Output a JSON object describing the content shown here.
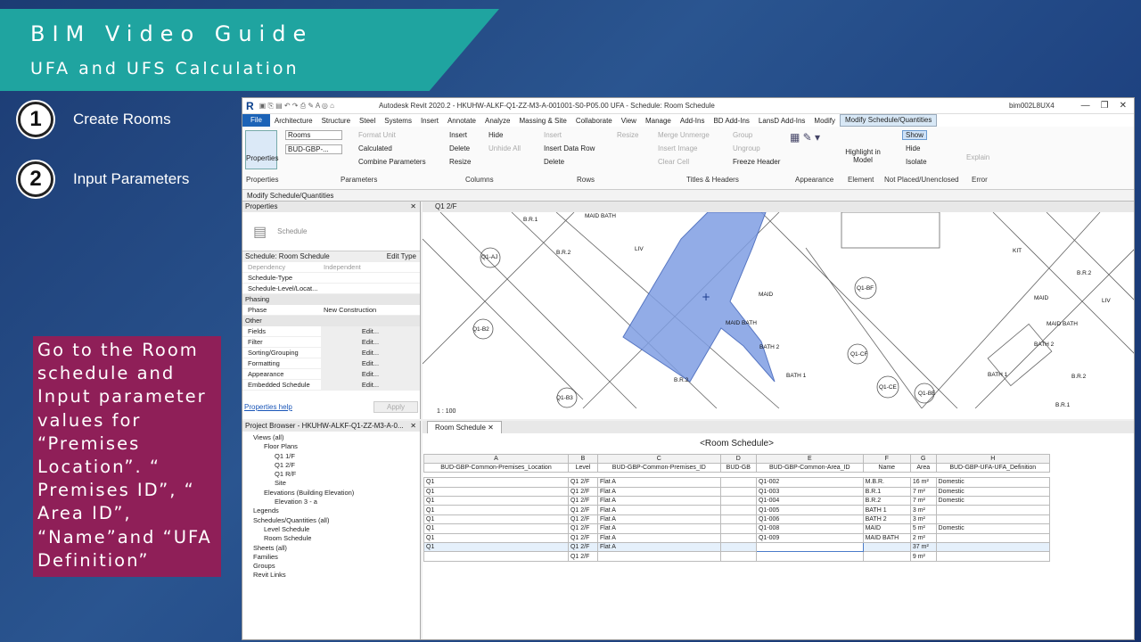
{
  "banner": {
    "title": "BIM Video Guide",
    "subtitle": "UFA and UFS Calculation"
  },
  "steps": [
    {
      "num": "1",
      "label": "Create Rooms"
    },
    {
      "num": "2",
      "label": "Input Parameters"
    }
  ],
  "note": "Go to the Room schedule and Input parameter values for “Premises Location”. “ Premises ID”, “ Area ID”, “Name”and “UFA Definition”",
  "app": {
    "title": "Autodesk Revit 2020.2 - HKUHW-ALKF-Q1-ZZ-M3-A-001001-S0-P05.00 UFA - Schedule: Room Schedule",
    "user": "bim002L8UX4",
    "menu": [
      "File",
      "Architecture",
      "Structure",
      "Steel",
      "Systems",
      "Insert",
      "Annotate",
      "Analyze",
      "Massing & Site",
      "Collaborate",
      "View",
      "Manage",
      "Add-Ins",
      "BD Add-Ins",
      "LansD Add-Ins",
      "Modify",
      "Modify Schedule/Quantities"
    ],
    "ribbon": {
      "properties": "Properties",
      "combo1": "Rooms",
      "combo2": "BUD-GBP-...",
      "format_unit": "Format Unit",
      "calculated": "Calculated",
      "combine": "Combine Parameters",
      "insert": "Insert",
      "delete": "Delete",
      "resize": "Resize",
      "hide": "Hide",
      "unhide": "Unhide All",
      "insert_r": "Insert",
      "insert_data_row": "Insert Data Row",
      "delete_r": "Delete",
      "resize_r": "Resize",
      "merge": "Merge Unmerge",
      "insert_image": "Insert Image",
      "clear_cell": "Clear Cell",
      "group": "Group",
      "ungroup": "Ungroup",
      "freeze": "Freeze Header",
      "highlight": "Highlight in Model",
      "show": "Show",
      "hide2": "Hide",
      "isolate": "Isolate",
      "explain": "Explain",
      "groups": [
        "Properties",
        "Parameters",
        "Columns",
        "Rows",
        "Titles & Headers",
        "Appearance",
        "Element",
        "Not Placed/Unenclosed",
        "Error"
      ]
    },
    "context": "Modify Schedule/Quantities"
  },
  "props": {
    "title": "Properties",
    "type": "Schedule",
    "selector": "Schedule: Room Schedule",
    "edit_type": "Edit Type",
    "rows1": [
      [
        "Dependency",
        "Independent"
      ],
      [
        "Schedule-Type",
        ""
      ],
      [
        "Schedule-Level/Locat...",
        ""
      ]
    ],
    "phasing": "Phasing",
    "phase": [
      "Phase",
      "New Construction"
    ],
    "other": "Other",
    "rows2": [
      "Fields",
      "Filter",
      "Sorting/Grouping",
      "Formatting",
      "Appearance",
      "Embedded Schedule"
    ],
    "edit": "Edit...",
    "help": "Properties help",
    "apply": "Apply"
  },
  "browser": {
    "title": "Project Browser - HKUHW-ALKF-Q1-ZZ-M3-A-0...",
    "items": [
      "Views (all)",
      "Floor Plans",
      "Q1 1/F",
      "Q1 2/F",
      "Q1 R/F",
      "Site",
      "Elevations (Building Elevation)",
      "Elevation 3 - a",
      "Legends",
      "Schedules/Quantities (all)",
      "Level Schedule",
      "Room Schedule",
      "Sheets (all)",
      "Families",
      "Groups",
      "Revit Links"
    ]
  },
  "plan": {
    "tab": "Q1 2/F",
    "scale": "1 : 100",
    "labels": [
      "B.R.1",
      "MAID BATH",
      "B.R.2",
      "LIV",
      "Q1-AJ",
      "MAID",
      "MAID BATH",
      "BATH 2",
      "B.R.2",
      "BATH 1",
      "Q1-B2",
      "Q1-B3",
      "Q1-BF",
      "Q1-CF",
      "Q1-CE",
      "Q1-BE",
      "KIT",
      "MAID",
      "MAID BATH",
      "BATH 2",
      "BATH 1",
      "B.R.2",
      "B.R.1",
      "LIV",
      "B.R.2"
    ]
  },
  "schedule": {
    "tab": "Room Schedule",
    "title": "<Room Schedule>",
    "letters": [
      "A",
      "B",
      "C",
      "D",
      "E",
      "F",
      "G",
      "H"
    ],
    "headers": [
      "BUD-GBP-Common-Premises_Location",
      "Level",
      "BUD-GBP-Common-Premises_ID",
      "BUD-GB",
      "BUD-GBP-Common-Area_ID",
      "Name",
      "Area",
      "BUD-GBP-UFA-UFA_Definition"
    ],
    "rows": [
      [
        "Q1",
        "Q1 2/F",
        "Flat A",
        "",
        "Q1-002",
        "M.B.R.",
        "16 m²",
        "Domestic"
      ],
      [
        "Q1",
        "Q1 2/F",
        "Flat A",
        "",
        "Q1-003",
        "B.R.1",
        "7 m²",
        "Domestic"
      ],
      [
        "Q1",
        "Q1 2/F",
        "Flat A",
        "",
        "Q1-004",
        "B.R.2",
        "7 m²",
        "Domestic"
      ],
      [
        "Q1",
        "Q1 2/F",
        "Flat A",
        "",
        "Q1-005",
        "BATH 1",
        "3 m²",
        ""
      ],
      [
        "Q1",
        "Q1 2/F",
        "Flat A",
        "",
        "Q1-006",
        "BATH 2",
        "3 m²",
        ""
      ],
      [
        "Q1",
        "Q1 2/F",
        "Flat A",
        "",
        "Q1-008",
        "MAID",
        "5 m²",
        "Domestic"
      ],
      [
        "Q1",
        "Q1 2/F",
        "Flat A",
        "",
        "Q1-009",
        "MAID BATH",
        "2 m²",
        ""
      ],
      [
        "Q1",
        "Q1 2/F",
        "Flat A",
        "",
        "",
        "",
        "37 m²",
        ""
      ],
      [
        "",
        "Q1 2/F",
        "",
        "",
        "",
        "",
        "9 m²",
        ""
      ]
    ]
  }
}
